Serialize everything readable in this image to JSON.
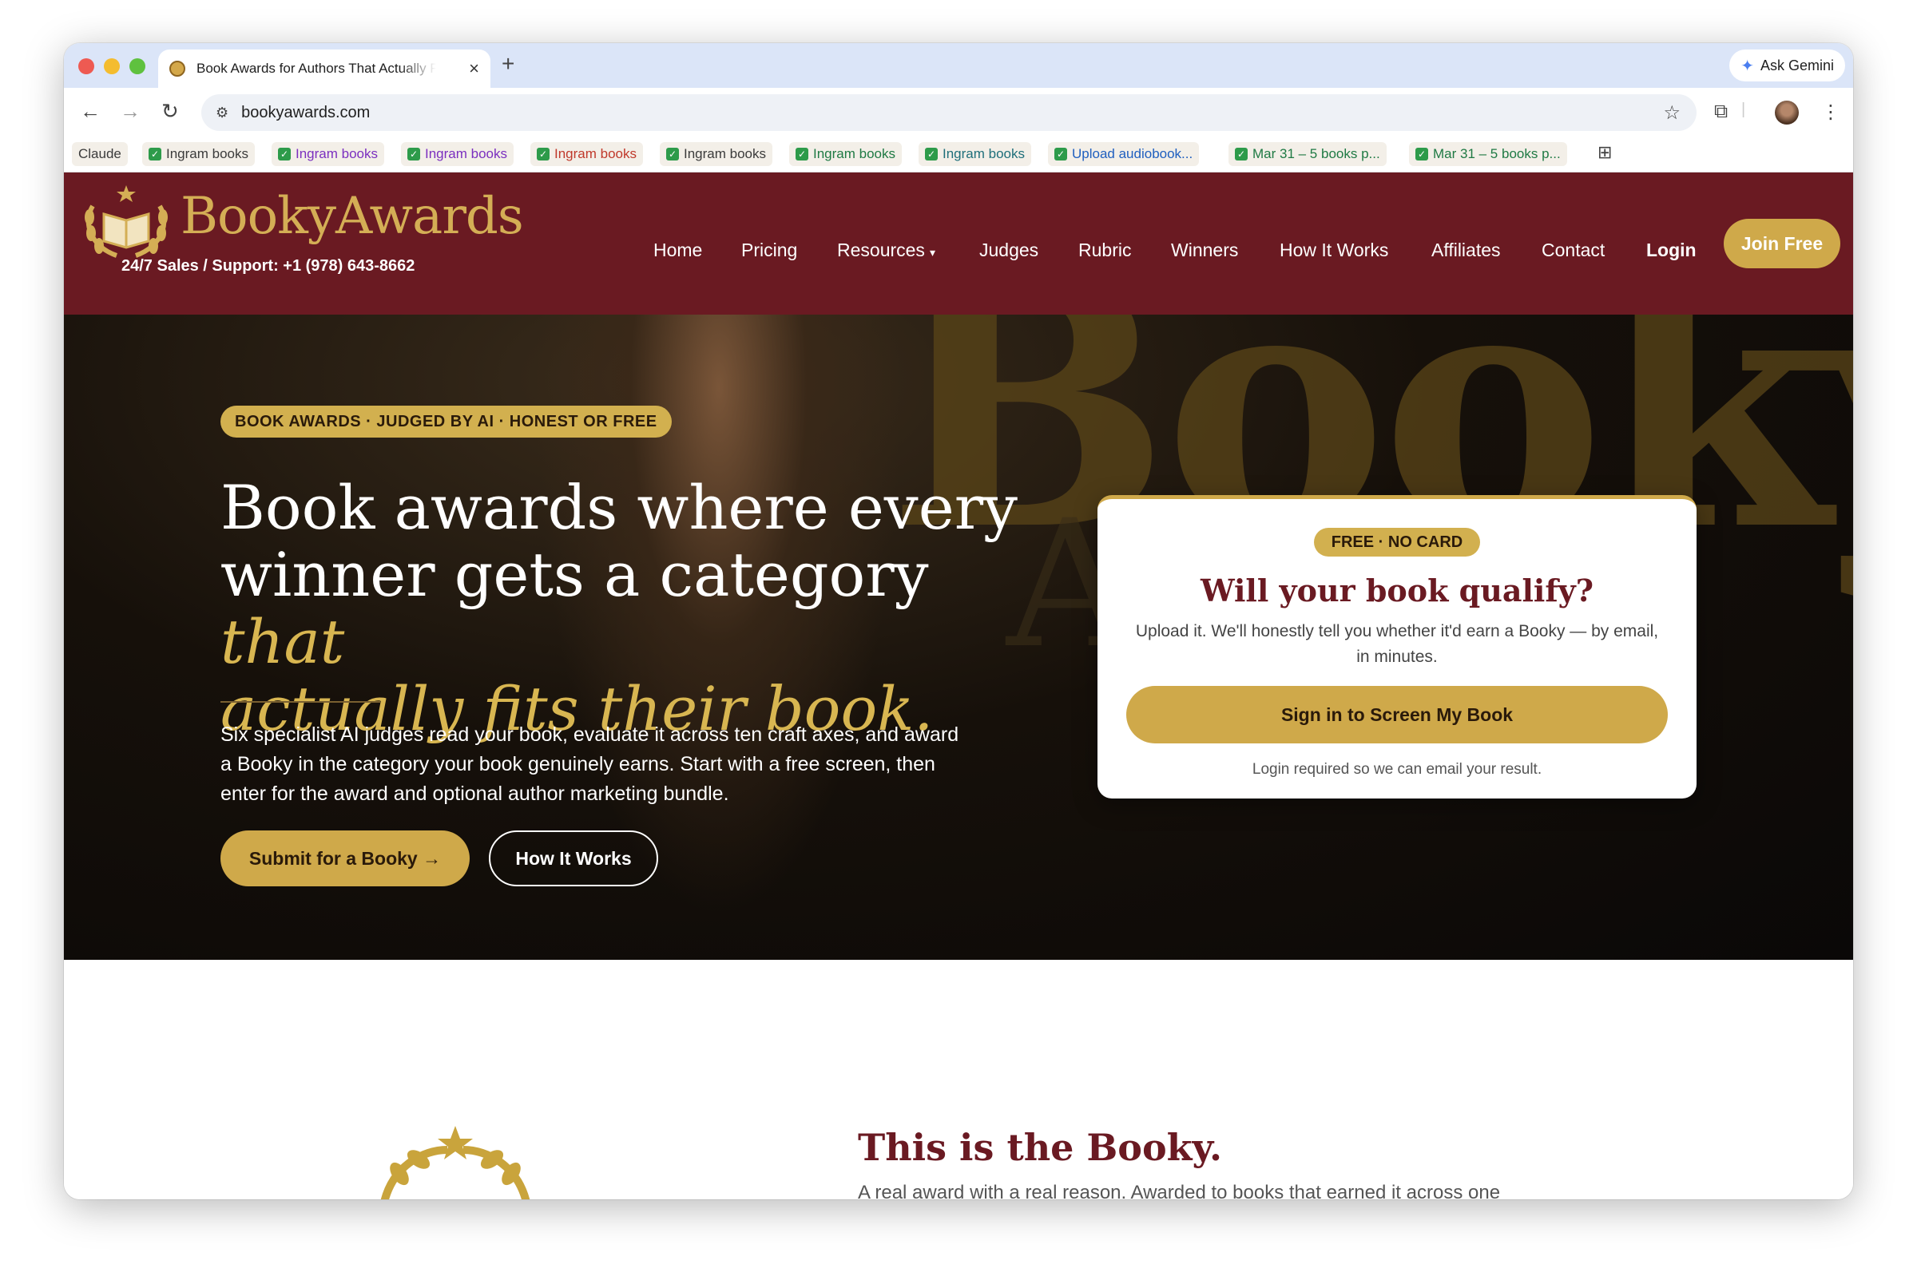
{
  "browser": {
    "tab_title": "Book Awards for Authors That Actually Fit",
    "new_tab": "+",
    "close_tab": "×",
    "gemini_label": "Ask Gemini",
    "url": "bookyawards.com"
  },
  "bookmarks": [
    {
      "label": "Claude",
      "check": false,
      "color": "#3b3b3b"
    },
    {
      "label": "Ingram books",
      "check": true,
      "color": "#3b3b3b"
    },
    {
      "label": "Ingram books",
      "check": true,
      "color": "#7b2fbf"
    },
    {
      "label": "Ingram books",
      "check": true,
      "color": "#7b2fbf"
    },
    {
      "label": "Ingram books",
      "check": true,
      "color": "#c0392b"
    },
    {
      "label": "Ingram books",
      "check": true,
      "color": "#3b3b3b"
    },
    {
      "label": "Ingram books",
      "check": true,
      "color": "#1f7a44"
    },
    {
      "label": "Ingram books",
      "check": true,
      "color": "#1f6f7a"
    },
    {
      "label": "Upload audiobook...",
      "check": true,
      "color": "#1f5fbf"
    },
    {
      "label": "Mar 31 – 5 books p...",
      "check": true,
      "color": "#1f7a44"
    },
    {
      "label": "Mar 31 – 5 books p...",
      "check": true,
      "color": "#1f7a44"
    }
  ],
  "header": {
    "logo_text": "BookyAwards",
    "support": "24/7 Sales / Support: +1 (978) 643-8662",
    "nav": [
      "Home",
      "Pricing",
      "Resources",
      "Judges",
      "Rubric",
      "Winners",
      "How It Works",
      "Affiliates",
      "Contact",
      "Login"
    ],
    "join": "Join Free"
  },
  "hero": {
    "badge": "BOOK AWARDS · JUDGED BY AI · HONEST OR FREE",
    "headline_1": "Book awards where every",
    "headline_2": "winner gets a category",
    "headline_gold_1": "that",
    "headline_gold_2": "actually fits their book.",
    "paragraph": "Six specialist AI judges read your book, evaluate it across ten craft axes, and award a Booky in the category your book genuinely earns. Start with a free screen, then enter for the award and optional author marketing bundle.",
    "submit": "Submit for a Booky →",
    "how": "How It Works"
  },
  "card": {
    "badge": "FREE · NO CARD",
    "title": "Will your book qualify?",
    "text": "Upload it. We'll honestly tell you whether it'd earn a Booky — by email, in minutes.",
    "button": "Sign in to Screen My Book",
    "note": "Login required so we can email your result."
  },
  "section2": {
    "title": "This is the Booky.",
    "subtitle": "A real award with a real reason. Awarded to books that earned it across one"
  },
  "colors": {
    "maroon": "#6a1a22",
    "gold": "#cfa94a",
    "hero_dark": "#0a0807"
  }
}
